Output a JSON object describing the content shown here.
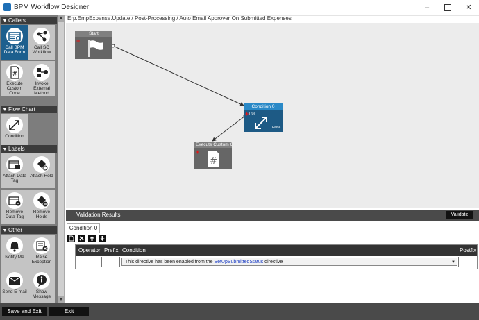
{
  "window": {
    "title": "BPM Workflow Designer",
    "minimize": "–",
    "close": "✕"
  },
  "breadcrumb": "Erp.EmpExpense.Update / Post-Processing / Auto Email Approver On Submitted Expenses",
  "sidebar": {
    "sections": [
      {
        "label": "Callers",
        "items": [
          {
            "label": "Call BPM Data Form",
            "icon": "form-icon"
          },
          {
            "label": "Call SC Workflow",
            "icon": "workflow-icon"
          },
          {
            "label": "Execute Custom Code",
            "icon": "hash-icon"
          },
          {
            "label": "Invoke External Method",
            "icon": "method-icon"
          }
        ]
      },
      {
        "label": "Flow Chart",
        "items": [
          {
            "label": "Condition",
            "icon": "condition-icon"
          }
        ]
      },
      {
        "label": "Labels",
        "items": [
          {
            "label": "Attach Data Tag",
            "icon": "attach-tag-icon"
          },
          {
            "label": "Attach Hold",
            "icon": "attach-hold-icon"
          },
          {
            "label": "Remove Data Tag",
            "icon": "remove-tag-icon"
          },
          {
            "label": "Remove Holds",
            "icon": "remove-holds-icon"
          }
        ]
      },
      {
        "label": "Other",
        "items": [
          {
            "label": "Notify Me",
            "icon": "bell-icon"
          },
          {
            "label": "Raise Exception",
            "icon": "exception-icon"
          },
          {
            "label": "Send E-mail",
            "icon": "mail-icon"
          },
          {
            "label": "Show Message",
            "icon": "info-icon"
          }
        ]
      }
    ]
  },
  "canvas": {
    "nodes": {
      "start": {
        "label": "Start"
      },
      "condition": {
        "label": "Condition 0",
        "true_label": "True",
        "false_label": "False"
      },
      "custom_code": {
        "label": "Execute Custom Code"
      }
    }
  },
  "validation": {
    "header": "Validation Results",
    "validate_button": "Validate",
    "tab": "Condition 0",
    "toolbar_buttons": [
      "new",
      "delete",
      "move-up",
      "move-down"
    ],
    "columns": [
      "Operator",
      "Prefix",
      "Condition",
      "Postfix"
    ],
    "row": {
      "condition_prefix": "This directive has been enabled from the ",
      "condition_link": "SetUpSubmittedStatus",
      "condition_suffix": " directive"
    }
  },
  "footer": {
    "save_exit": "Save and Exit",
    "exit": "Exit"
  },
  "colors": {
    "condition_header": "#2a89c7",
    "condition_body": "#1d5a85",
    "selected_tool": "#1c5f8e",
    "gray_node": "#666666"
  }
}
